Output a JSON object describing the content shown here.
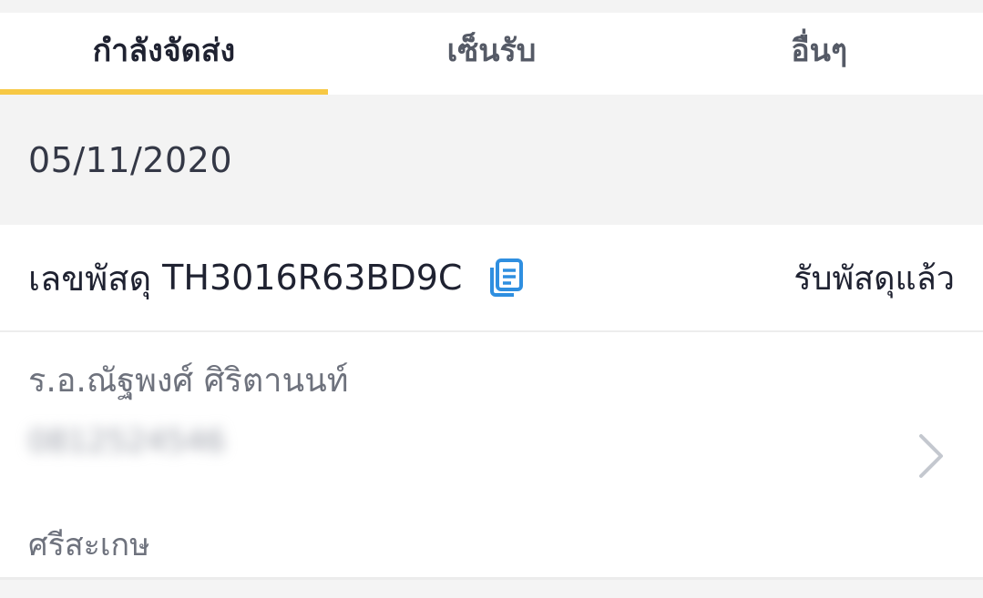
{
  "tabs": [
    {
      "label": "กำลังจัดส่ง",
      "active": true
    },
    {
      "label": "เซ็นรับ",
      "active": false
    },
    {
      "label": "อื่นๆ",
      "active": false
    }
  ],
  "section": {
    "date": "05/11/2020"
  },
  "parcel": {
    "label": "เลขพัสดุ",
    "tracking_number": "TH3016R63BD9C",
    "status": "รับพัสดุแล้ว",
    "copy_icon": "copy-icon",
    "recipient_name": "ร.อ.ณัฐพงศ์ ศิริตานนท์",
    "phone": "0812524546",
    "province": "ศรีสะเกษ",
    "chevron_icon": "chevron-right-icon"
  },
  "colors": {
    "accent": "#f7c844",
    "copy_icon": "#2f8fe0",
    "text_dark": "#1f2231",
    "text_muted": "#6e727d",
    "background_gray": "#f3f3f3"
  }
}
